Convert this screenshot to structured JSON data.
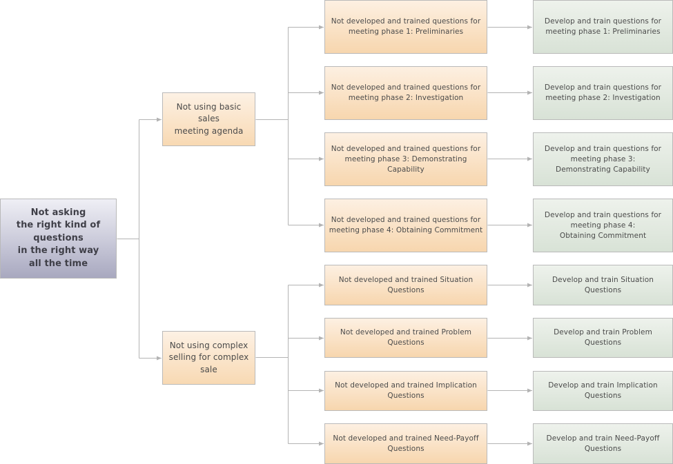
{
  "diagram": {
    "root": {
      "label": "Not asking\nthe right kind of\nquestions\nin the right way\nall the time"
    },
    "causes": [
      {
        "label": "Not using basic sales\nmeeting agenda",
        "problems": [
          {
            "label": "Not developed and trained questions for\nmeeting phase 1: Preliminaries",
            "solution": "Develop and train questions for\nmeeting phase 1: Preliminaries"
          },
          {
            "label": "Not developed and trained questions for\nmeeting phase 2: Investigation",
            "solution": "Develop and train questions for\nmeeting phase 2: Investigation"
          },
          {
            "label": "Not developed and trained questions for\nmeeting phase 3: Demonstrating\nCapability",
            "solution": "Develop and train questions for\nmeeting phase 3:\nDemonstrating Capability"
          },
          {
            "label": "Not developed and trained questions for\nmeeting phase 4: Obtaining Commitment",
            "solution": "Develop and train questions for\nmeeting phase 4:\nObtaining Commitment"
          }
        ]
      },
      {
        "label": "Not using complex\nselling for complex\nsale",
        "problems": [
          {
            "label": "Not developed and trained Situation\nQuestions",
            "solution": "Develop and train Situation\nQuestions"
          },
          {
            "label": "Not developed and trained Problem\nQuestions",
            "solution": "Develop and train Problem\nQuestions"
          },
          {
            "label": "Not developed and trained Implication\nQuestions",
            "solution": "Develop and train Implication\nQuestions"
          },
          {
            "label": "Not developed and trained Need-Payoff\nQuestions",
            "solution": "Develop and train Need-Payoff\nQuestions"
          }
        ]
      }
    ],
    "colors": {
      "connector": "#b3b3b3",
      "root_fill": "#b8b8cc",
      "cause_fill": "#f8d9b3",
      "solution_fill": "#d8e2d6"
    }
  }
}
